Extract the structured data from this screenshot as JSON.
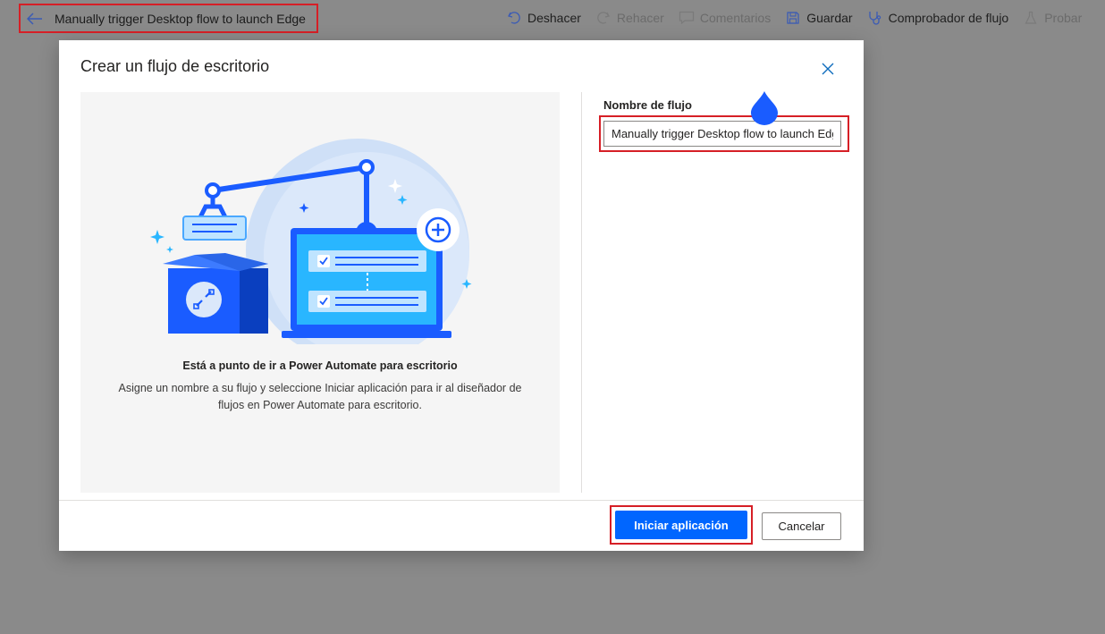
{
  "topbar": {
    "flow_title": "Manually trigger Desktop flow to launch Edge",
    "commands": {
      "undo": "Deshacer",
      "redo": "Rehacer",
      "comments": "Comentarios",
      "save": "Guardar",
      "flow_checker": "Comprobador de flujo",
      "test": "Probar"
    }
  },
  "dialog": {
    "title": "Crear un flujo de escritorio",
    "intro_heading": "Está a punto de ir a Power Automate para escritorio",
    "intro_body": "Asigne un nombre a su flujo y seleccione Iniciar aplicación para ir al diseñador de flujos en Power Automate para escritorio.",
    "field_label": "Nombre de flujo",
    "field_value": "Manually trigger Desktop flow to launch Edge",
    "primary_label": "Iniciar aplicación",
    "secondary_label": "Cancelar"
  },
  "colors": {
    "overlay": "#8a8a8a",
    "highlight": "#d61f26",
    "primary": "#0066ff",
    "accent_blue": "#0f6cbd"
  }
}
